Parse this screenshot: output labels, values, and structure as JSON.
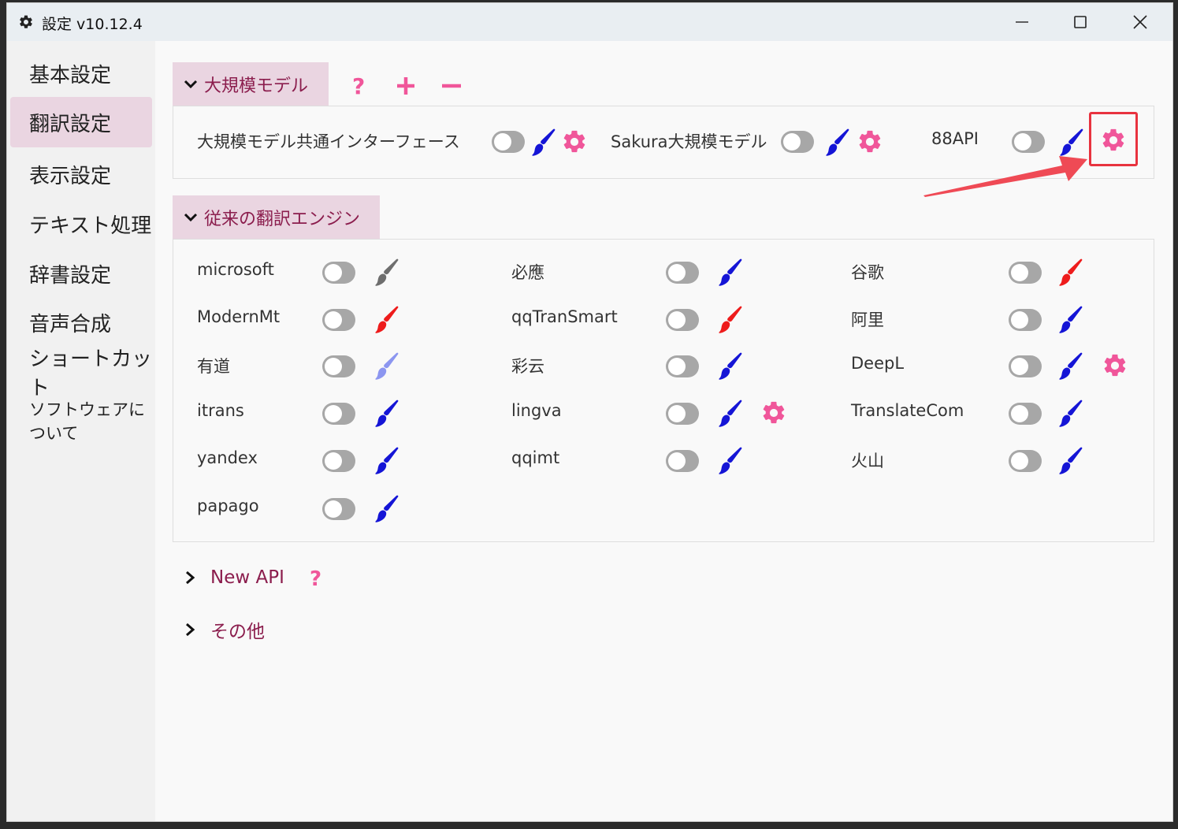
{
  "window": {
    "title": "設定 v10.12.4"
  },
  "sidebar": {
    "items": [
      {
        "label": "基本設定"
      },
      {
        "label": "翻訳設定"
      },
      {
        "label": "表示設定"
      },
      {
        "label": "テキスト処理"
      },
      {
        "label": "辞書設定"
      },
      {
        "label": "音声合成"
      },
      {
        "label": "ショートカット"
      },
      {
        "label": "ソフトウェアについて"
      }
    ],
    "active_index": 1
  },
  "llm_section": {
    "title": "大規模モデル",
    "help_icon": "question-icon",
    "add_icon": "plus-icon",
    "remove_icon": "minus-icon",
    "engines": [
      {
        "label": "大規模モデル共通インターフェース",
        "enabled": false,
        "brush_color": "#1515d6",
        "has_settings": true
      },
      {
        "label": "Sakura大規模モデル",
        "enabled": false,
        "brush_color": "#1515d6",
        "has_settings": true
      },
      {
        "label": "88API",
        "enabled": false,
        "brush_color": "#1515d6",
        "has_settings": true,
        "highlighted": true
      }
    ]
  },
  "classic_section": {
    "title": "従来の翻訳エンジン",
    "engines": [
      {
        "label": "microsoft",
        "enabled": false,
        "brush_color": "#6e6e6e"
      },
      {
        "label": "必應",
        "enabled": false,
        "brush_color": "#1515d6"
      },
      {
        "label": "谷歌",
        "enabled": false,
        "brush_color": "#ee1c1c"
      },
      {
        "label": "ModernMt",
        "enabled": false,
        "brush_color": "#ee1c1c"
      },
      {
        "label": "qqTranSmart",
        "enabled": false,
        "brush_color": "#ee1c1c"
      },
      {
        "label": "阿里",
        "enabled": false,
        "brush_color": "#1515d6"
      },
      {
        "label": "有道",
        "enabled": false,
        "brush_color": "#8c96f0"
      },
      {
        "label": "彩云",
        "enabled": false,
        "brush_color": "#1515d6"
      },
      {
        "label": "DeepL",
        "enabled": false,
        "brush_color": "#1515d6",
        "has_settings": true
      },
      {
        "label": "itrans",
        "enabled": false,
        "brush_color": "#1515d6"
      },
      {
        "label": "lingva",
        "enabled": false,
        "brush_color": "#1515d6",
        "has_settings": true
      },
      {
        "label": "TranslateCom",
        "enabled": false,
        "brush_color": "#1515d6"
      },
      {
        "label": "yandex",
        "enabled": false,
        "brush_color": "#1515d6"
      },
      {
        "label": "qqimt",
        "enabled": false,
        "brush_color": "#1515d6"
      },
      {
        "label": "火山",
        "enabled": false,
        "brush_color": "#1515d6"
      },
      {
        "label": "papago",
        "enabled": false,
        "brush_color": "#1515d6"
      }
    ]
  },
  "collapsed_sections": [
    {
      "title": "New API",
      "has_help": true
    },
    {
      "title": "その他",
      "has_help": false
    }
  ],
  "colors": {
    "accent": "#8b1d4d",
    "pink": "#f0569a",
    "header_bg": "#ead5e1",
    "highlight": "#e8333f"
  }
}
